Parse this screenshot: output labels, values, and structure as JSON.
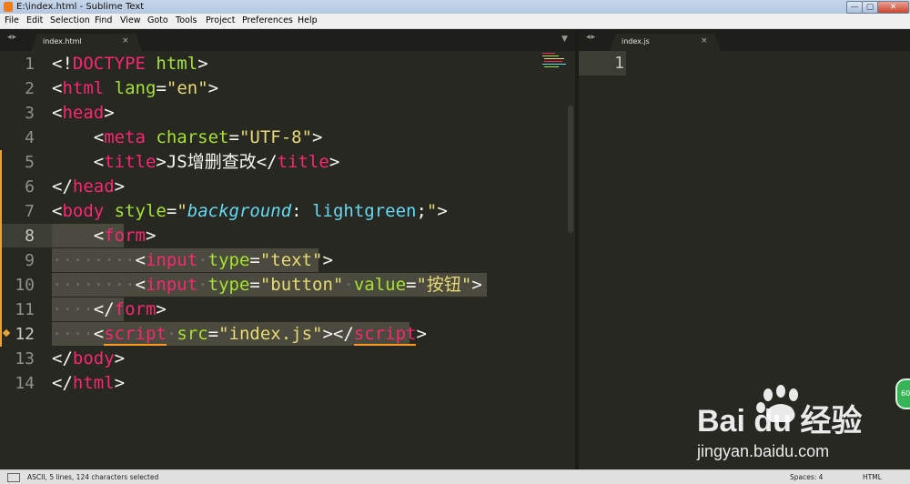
{
  "window": {
    "title": "E:\\index.html - Sublime Text",
    "controls": {
      "minimize": "—",
      "maximize": "▢",
      "close": "✕"
    }
  },
  "menu": [
    "File",
    "Edit",
    "Selection",
    "Find",
    "View",
    "Goto",
    "Tools",
    "Project",
    "Preferences",
    "Help"
  ],
  "tabs": {
    "left": {
      "label": "index.html",
      "close": "×"
    },
    "right": {
      "label": "index.js",
      "close": "×"
    },
    "nav_arrows": "◂▸",
    "dropdown": "▼"
  },
  "editor_left": {
    "lines": [
      {
        "num": "1",
        "segments": [
          [
            "p",
            "<!"
          ],
          [
            "tag",
            "DOCTYPE"
          ],
          [
            "p",
            " "
          ],
          [
            "attr",
            "html"
          ],
          [
            "p",
            ">"
          ]
        ]
      },
      {
        "num": "2",
        "segments": [
          [
            "p",
            "<"
          ],
          [
            "tag",
            "html"
          ],
          [
            "p",
            " "
          ],
          [
            "attr",
            "lang"
          ],
          [
            "p",
            "="
          ],
          [
            "str",
            "\"en\""
          ],
          [
            "p",
            ">"
          ]
        ]
      },
      {
        "num": "3",
        "segments": [
          [
            "p",
            "<"
          ],
          [
            "tag",
            "head"
          ],
          [
            "p",
            ">"
          ]
        ]
      },
      {
        "num": "4",
        "segments": [
          [
            "p",
            "    <"
          ],
          [
            "tag",
            "meta"
          ],
          [
            "p",
            " "
          ],
          [
            "attr",
            "charset"
          ],
          [
            "p",
            "="
          ],
          [
            "str",
            "\"UTF-8\""
          ],
          [
            "p",
            ">"
          ]
        ]
      },
      {
        "num": "5",
        "segments": [
          [
            "p",
            "    <"
          ],
          [
            "tag",
            "title"
          ],
          [
            "p",
            ">JS增删查改</"
          ],
          [
            "tag",
            "title"
          ],
          [
            "p",
            ">"
          ]
        ]
      },
      {
        "num": "6",
        "segments": [
          [
            "p",
            "</"
          ],
          [
            "tag",
            "head"
          ],
          [
            "p",
            ">"
          ]
        ]
      },
      {
        "num": "7",
        "segments": [
          [
            "p",
            "<"
          ],
          [
            "tag",
            "body"
          ],
          [
            "p",
            " "
          ],
          [
            "attr",
            "style"
          ],
          [
            "p",
            "="
          ],
          [
            "str",
            "\""
          ],
          [
            "it",
            "background"
          ],
          [
            "p",
            ": "
          ],
          [
            "cons",
            "lightgreen"
          ],
          [
            "p",
            ";"
          ],
          [
            "str",
            "\""
          ],
          [
            "p",
            ">"
          ]
        ]
      },
      {
        "num": "8",
        "segments": [
          [
            "p",
            "    <"
          ],
          [
            "tag",
            "form"
          ],
          [
            "p",
            ">"
          ]
        ]
      },
      {
        "num": "9",
        "segments": [
          [
            "ws",
            "········"
          ],
          [
            "p",
            "<"
          ],
          [
            "tag",
            "input"
          ],
          [
            "ws",
            "·"
          ],
          [
            "attr",
            "type"
          ],
          [
            "p",
            "="
          ],
          [
            "str",
            "\"text\""
          ],
          [
            "p",
            ">"
          ]
        ]
      },
      {
        "num": "10",
        "segments": [
          [
            "ws",
            "········"
          ],
          [
            "p",
            "<"
          ],
          [
            "tag",
            "input"
          ],
          [
            "ws",
            "·"
          ],
          [
            "attr",
            "type"
          ],
          [
            "p",
            "="
          ],
          [
            "str",
            "\"button\""
          ],
          [
            "ws",
            "·"
          ],
          [
            "attr",
            "value"
          ],
          [
            "p",
            "="
          ],
          [
            "str",
            "\"按钮\""
          ],
          [
            "p",
            ">"
          ]
        ]
      },
      {
        "num": "11",
        "segments": [
          [
            "ws",
            "····"
          ],
          [
            "p",
            "</"
          ],
          [
            "tag",
            "form"
          ],
          [
            "p",
            ">"
          ]
        ]
      },
      {
        "num": "12",
        "segments": [
          [
            "ws",
            "····"
          ],
          [
            "p",
            "<"
          ],
          [
            "err",
            "script"
          ],
          [
            "ws",
            "·"
          ],
          [
            "attr",
            "src"
          ],
          [
            "p",
            "="
          ],
          [
            "str",
            "\"index.js\""
          ],
          [
            "p",
            "></"
          ],
          [
            "err",
            "script"
          ],
          [
            "p",
            ">"
          ]
        ]
      },
      {
        "num": "13",
        "segments": [
          [
            "p",
            "</"
          ],
          [
            "tag",
            "body"
          ],
          [
            "p",
            ">"
          ]
        ]
      },
      {
        "num": "14",
        "segments": [
          [
            "p",
            "</"
          ],
          [
            "tag",
            "html"
          ],
          [
            "p",
            ">"
          ]
        ]
      }
    ]
  },
  "editor_right": {
    "line_number": "1"
  },
  "watermark": {
    "text": "Bai du 经验",
    "url": "jingyan.baidu.com",
    "badge": "60"
  },
  "status": {
    "left": "ASCII, 5 lines, 124 characters selected",
    "spaces": "Spaces: 4",
    "syntax": "HTML"
  },
  "colors": {
    "background": "#272822",
    "tag": "#f92672",
    "attribute": "#a6e22e",
    "string": "#e6db74",
    "constant": "#66d9ef",
    "selection": "#4b4a3e"
  }
}
